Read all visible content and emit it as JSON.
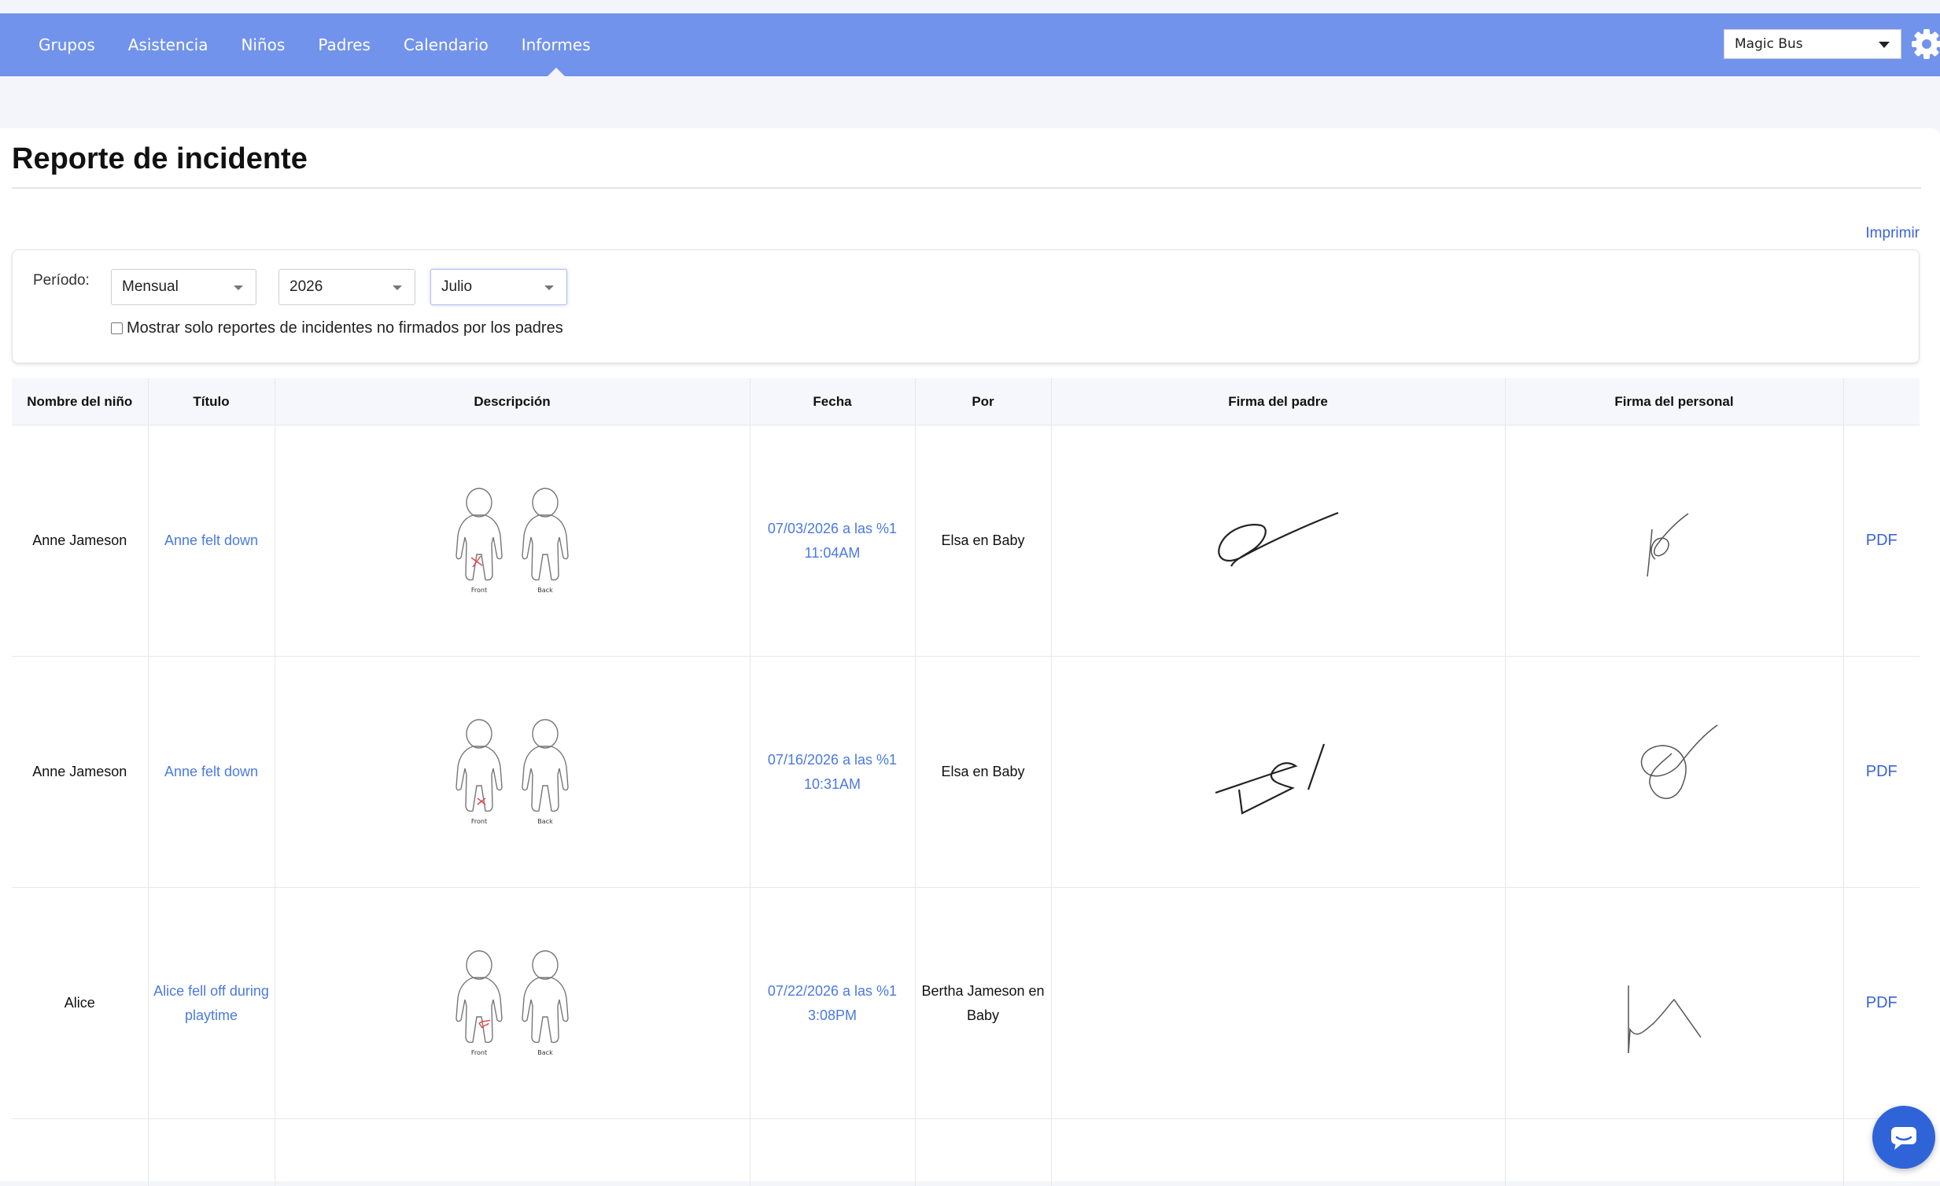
{
  "nav": {
    "items": [
      {
        "label": "Grupos"
      },
      {
        "label": "Asistencia"
      },
      {
        "label": "Niños"
      },
      {
        "label": "Padres"
      },
      {
        "label": "Calendario"
      },
      {
        "label": "Informes"
      }
    ],
    "active": "Informes"
  },
  "header": {
    "school_select": "Magic Bus"
  },
  "page": {
    "title": "Reporte de incidente",
    "print_label": "Imprimir"
  },
  "filters": {
    "period_label": "Período:",
    "period": "Mensual",
    "year": "2026",
    "month": "Julio",
    "unsigned_only_label": "Mostrar solo reportes de incidentes no firmados por los padres",
    "unsigned_only_checked": false
  },
  "table": {
    "columns": [
      "Nombre del niño",
      "Título",
      "Descripción",
      "Fecha",
      "Por",
      "Firma del padre",
      "Firma del personal",
      ""
    ],
    "rows": [
      {
        "child": "Anne Jameson",
        "title": "Anne felt down",
        "date_line1": "07/03/2026 a las %1",
        "date_line2": "11:04AM",
        "by": "Elsa en Baby",
        "pdf": "PDF"
      },
      {
        "child": "Anne Jameson",
        "title": "Anne felt down",
        "date_line1": "07/16/2026 a las %1",
        "date_line2": "10:31AM",
        "by": "Elsa en Baby",
        "pdf": "PDF"
      },
      {
        "child": "Alice",
        "title": "Alice fell off during playtime",
        "date_line1": "07/22/2026 a las %1",
        "date_line2": "3:08PM",
        "by": "Bertha Jameson en Baby",
        "pdf": "PDF"
      }
    ],
    "body_diagram_labels": {
      "front": "Front",
      "back": "Back"
    }
  },
  "colors": {
    "topbar": "#7293ec",
    "link": "#4a7ae0",
    "injury_mark": "#e04a4a",
    "chat_button": "#2f64d8"
  },
  "icons": {
    "settings": "gear-icon",
    "chat": "chat-icon",
    "dropdown": "chevron-down-icon"
  }
}
